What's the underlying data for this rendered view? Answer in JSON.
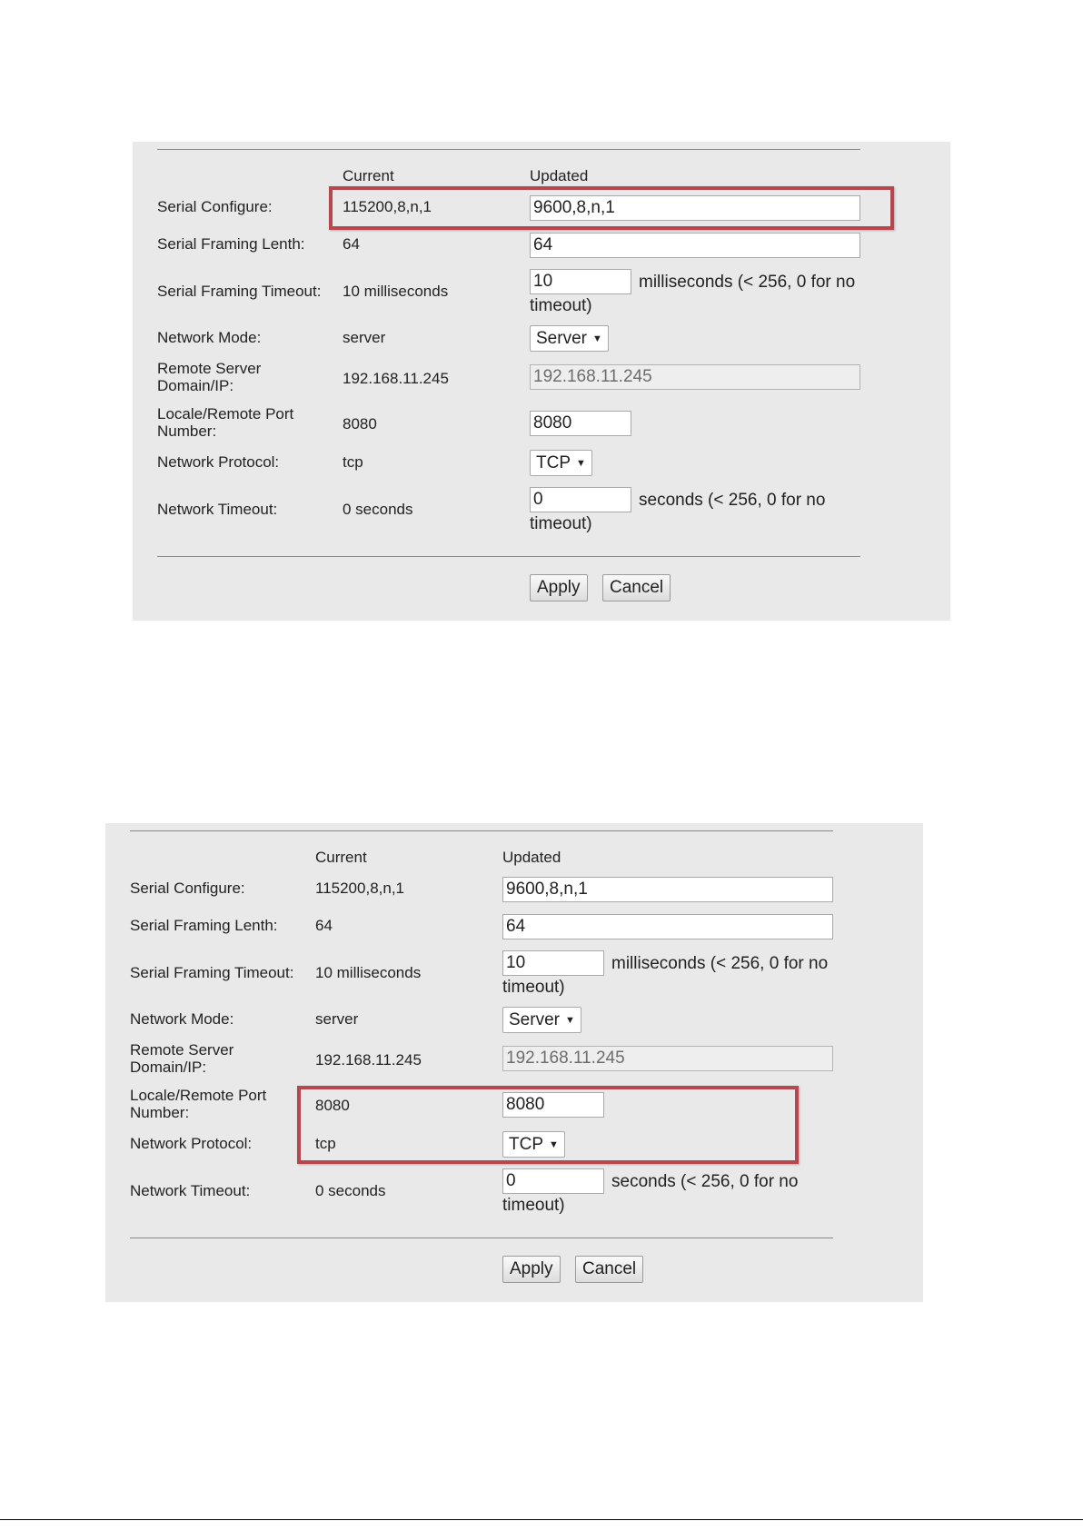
{
  "panels": [
    {
      "header_current": "Current",
      "header_updated": "Updated",
      "rows": {
        "serial_configure": {
          "label": "Serial Configure:",
          "current": "115200,8,n,1",
          "updated": "9600,8,n,1"
        },
        "serial_framing_length": {
          "label": "Serial Framing Lenth:",
          "current": "64",
          "updated": "64"
        },
        "serial_framing_timeout": {
          "label": "Serial Framing Timeout:",
          "current": "10 milliseconds",
          "updated": "10",
          "note": "milliseconds (< 256, 0 for no timeout)"
        },
        "network_mode": {
          "label": "Network Mode:",
          "current": "server",
          "selected": "Server"
        },
        "remote_server": {
          "label": "Remote Server Domain/IP:",
          "current": "192.168.11.245",
          "updated": "192.168.11.245"
        },
        "port_number": {
          "label": "Locale/Remote Port Number:",
          "current": "8080",
          "updated": "8080"
        },
        "network_protocol": {
          "label": "Network Protocol:",
          "current": "tcp",
          "selected": "TCP"
        },
        "network_timeout": {
          "label": "Network Timeout:",
          "current": "0 seconds",
          "updated": "0",
          "note": "seconds (< 256, 0 for no timeout)"
        }
      },
      "apply_label": "Apply",
      "cancel_label": "Cancel"
    },
    {
      "header_current": "Current",
      "header_updated": "Updated",
      "rows": {
        "serial_configure": {
          "label": "Serial Configure:",
          "current": "115200,8,n,1",
          "updated": "9600,8,n,1"
        },
        "serial_framing_length": {
          "label": "Serial Framing Lenth:",
          "current": "64",
          "updated": "64"
        },
        "serial_framing_timeout": {
          "label": "Serial Framing Timeout:",
          "current": "10 milliseconds",
          "updated": "10",
          "note": "milliseconds (< 256, 0 for no timeout)"
        },
        "network_mode": {
          "label": "Network Mode:",
          "current": "server",
          "selected": "Server"
        },
        "remote_server": {
          "label": "Remote Server Domain/IP:",
          "current": "192.168.11.245",
          "updated": "192.168.11.245"
        },
        "port_number": {
          "label": "Locale/Remote Port Number:",
          "current": "8080",
          "updated": "8080"
        },
        "network_protocol": {
          "label": "Network Protocol:",
          "current": "tcp",
          "selected": "TCP"
        },
        "network_timeout": {
          "label": "Network Timeout:",
          "current": "0 seconds",
          "updated": "0",
          "note": "seconds (< 256, 0 for no timeout)"
        }
      },
      "apply_label": "Apply",
      "cancel_label": "Cancel"
    }
  ],
  "highlight_color": "#b5474d",
  "panel_background": "#e9e9e9"
}
